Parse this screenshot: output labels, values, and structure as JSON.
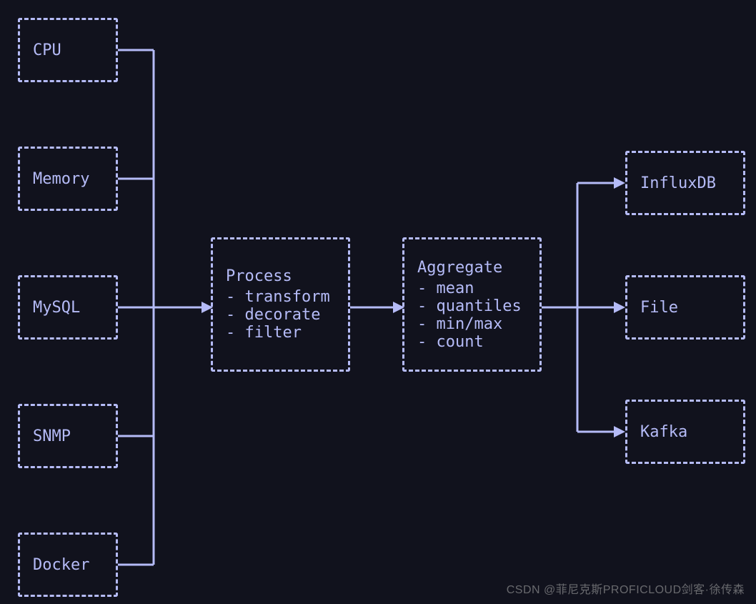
{
  "inputs": {
    "cpu": {
      "label": "CPU"
    },
    "memory": {
      "label": "Memory"
    },
    "mysql": {
      "label": "MySQL"
    },
    "snmp": {
      "label": "SNMP"
    },
    "docker": {
      "label": "Docker"
    }
  },
  "process": {
    "title": "Process",
    "items": [
      "transform",
      "decorate",
      "filter"
    ]
  },
  "aggregate": {
    "title": "Aggregate",
    "items": [
      "mean",
      "quantiles",
      "min/max",
      "count"
    ]
  },
  "outputs": {
    "influxdb": {
      "label": "InfluxDB"
    },
    "file": {
      "label": "File"
    },
    "kafka": {
      "label": "Kafka"
    }
  },
  "watermark": "CSDN @菲尼克斯PROFICLOUD剑客·徐传森"
}
